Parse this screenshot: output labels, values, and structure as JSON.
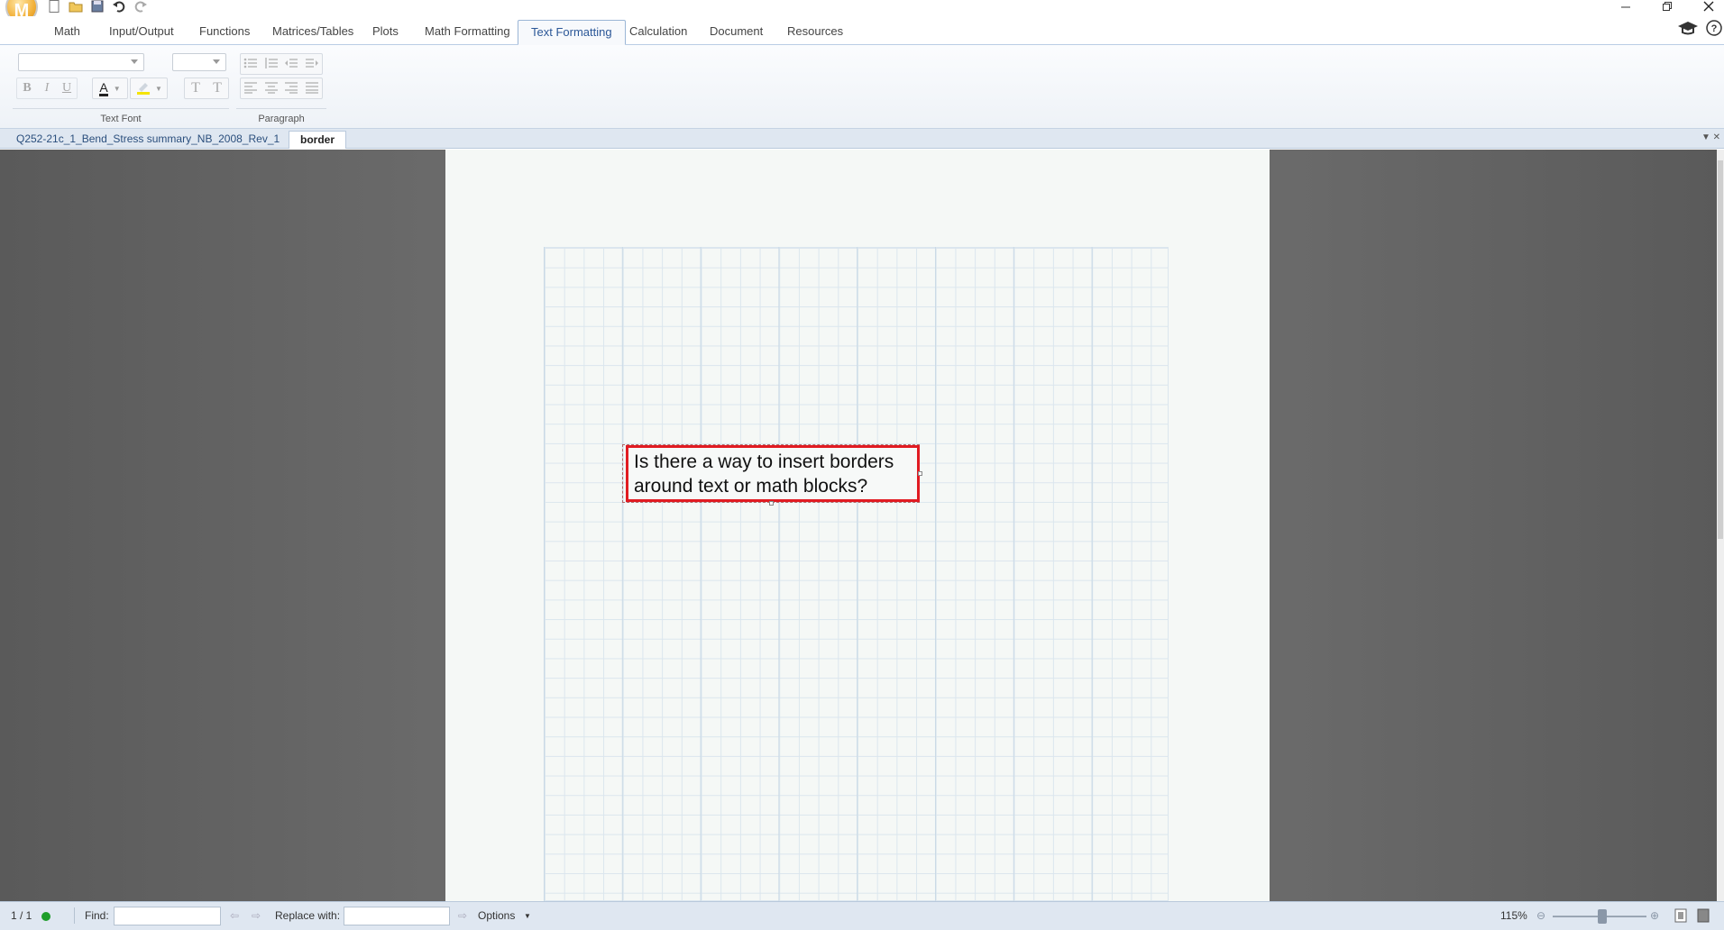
{
  "app": {
    "logo_letter": "M",
    "quick_access": [
      {
        "name": "new-document-icon"
      },
      {
        "name": "open-folder-icon"
      },
      {
        "name": "save-icon"
      },
      {
        "name": "undo-icon"
      },
      {
        "name": "redo-icon"
      }
    ],
    "window_controls": [
      "minimize-icon",
      "restore-icon",
      "close-icon"
    ]
  },
  "ribbon": {
    "tabs": [
      {
        "label": "Math"
      },
      {
        "label": "Input/Output"
      },
      {
        "label": "Functions"
      },
      {
        "label": "Matrices/Tables"
      },
      {
        "label": "Plots"
      },
      {
        "label": "Math Formatting"
      },
      {
        "label": "Text Formatting",
        "active": true
      },
      {
        "label": "Calculation"
      },
      {
        "label": "Document"
      },
      {
        "label": "Resources"
      }
    ],
    "groups": {
      "text_font": {
        "label": "Text Font",
        "font_family_value": "",
        "font_size_value": "",
        "buttons": [
          "B",
          "I",
          "U",
          "A"
        ]
      },
      "paragraph": {
        "label": "Paragraph"
      }
    }
  },
  "documents": {
    "tabs": [
      {
        "label": "Q252-21c_1_Bend_Stress summary_NB_2008_Rev_1",
        "active": false
      },
      {
        "label": "border",
        "active": true
      }
    ]
  },
  "worksheet": {
    "text_region": {
      "line1": "Is there a way to insert borders",
      "line2": "around text or math blocks?",
      "border_color": "#e11b22"
    }
  },
  "status": {
    "page_indicator": "1 / 1",
    "find_label": "Find:",
    "find_value": "",
    "replace_label": "Replace with:",
    "replace_value": "",
    "options_label": "Options",
    "zoom": "115%",
    "calc_status_color": "#1e9e2a"
  }
}
